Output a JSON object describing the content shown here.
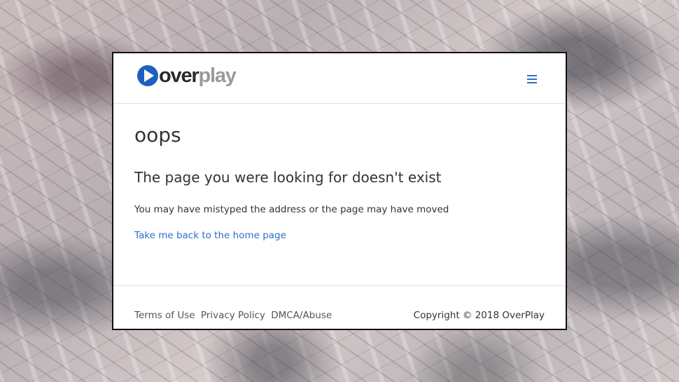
{
  "background": {
    "description_icon": "marble-texture"
  },
  "header": {
    "logo": {
      "part_dark": "over",
      "part_light": "play",
      "icon": "play-circle-icon",
      "brand_color": "#1f5fbf"
    },
    "menu_icon": "hamburger-menu-icon"
  },
  "main": {
    "title": "oops",
    "subtitle": "The page you were looking for doesn't exist",
    "description": "You may have mistyped the address or the page may have moved",
    "home_link": "Take me back to the home page"
  },
  "footer": {
    "links": [
      "Terms of Use",
      "Privacy Policy",
      "DMCA/Abuse"
    ],
    "copyright": "Copyright © 2018 OverPlay"
  },
  "colors": {
    "link": "#2e6fc6",
    "text": "#333333",
    "border": "#111111"
  }
}
